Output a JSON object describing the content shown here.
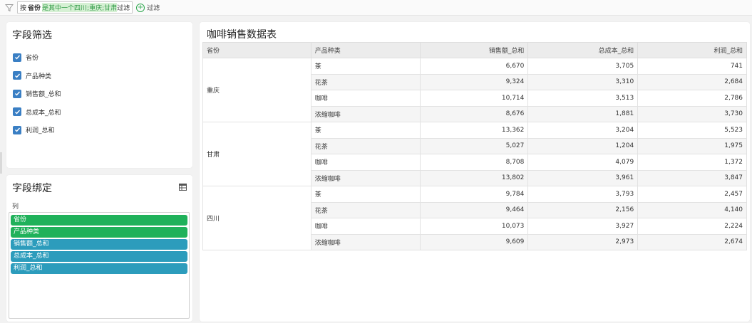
{
  "filter": {
    "prefix": "按",
    "field": "省份",
    "condition": "是其中一个四川;重庆;甘肃",
    "suffix": "过滤",
    "add_label": "过滤"
  },
  "field_filter": {
    "title": "字段筛选",
    "items": [
      "省份",
      "产品种类",
      "销售额_总和",
      "总成本_总和",
      "利润_总和"
    ]
  },
  "field_bind": {
    "title": "字段绑定",
    "column_label": "列",
    "items": [
      {
        "label": "省份",
        "color": "#1fb15a"
      },
      {
        "label": "产品种类",
        "color": "#1fb15a"
      },
      {
        "label": "销售额_总和",
        "color": "#2c9cbc"
      },
      {
        "label": "总成本_总和",
        "color": "#2c9cbc"
      },
      {
        "label": "利润_总和",
        "color": "#2c9cbc"
      }
    ]
  },
  "table": {
    "title": "咖啡销售数据表",
    "headers": [
      "省份",
      "产品种类",
      "销售额_总和",
      "总成本_总和",
      "利润_总和"
    ],
    "groups": [
      {
        "province": "重庆",
        "rows": [
          {
            "product": "茶",
            "sales": "6,670",
            "cost": "3,705",
            "profit": "741"
          },
          {
            "product": "花茶",
            "sales": "9,324",
            "cost": "3,310",
            "profit": "2,684"
          },
          {
            "product": "咖啡",
            "sales": "10,714",
            "cost": "3,513",
            "profit": "2,786"
          },
          {
            "product": "浓缩咖啡",
            "sales": "8,676",
            "cost": "1,881",
            "profit": "3,730"
          }
        ]
      },
      {
        "province": "甘肃",
        "rows": [
          {
            "product": "茶",
            "sales": "13,362",
            "cost": "3,204",
            "profit": "5,523"
          },
          {
            "product": "花茶",
            "sales": "5,027",
            "cost": "1,204",
            "profit": "1,975"
          },
          {
            "product": "咖啡",
            "sales": "8,708",
            "cost": "4,079",
            "profit": "1,372"
          },
          {
            "product": "浓缩咖啡",
            "sales": "13,802",
            "cost": "3,961",
            "profit": "3,847"
          }
        ]
      },
      {
        "province": "四川",
        "rows": [
          {
            "product": "茶",
            "sales": "9,784",
            "cost": "3,793",
            "profit": "2,457"
          },
          {
            "product": "花茶",
            "sales": "9,464",
            "cost": "2,156",
            "profit": "4,140"
          },
          {
            "product": "咖啡",
            "sales": "10,073",
            "cost": "3,927",
            "profit": "2,224"
          },
          {
            "product": "浓缩咖啡",
            "sales": "9,609",
            "cost": "2,973",
            "profit": "2,674"
          }
        ]
      }
    ]
  }
}
